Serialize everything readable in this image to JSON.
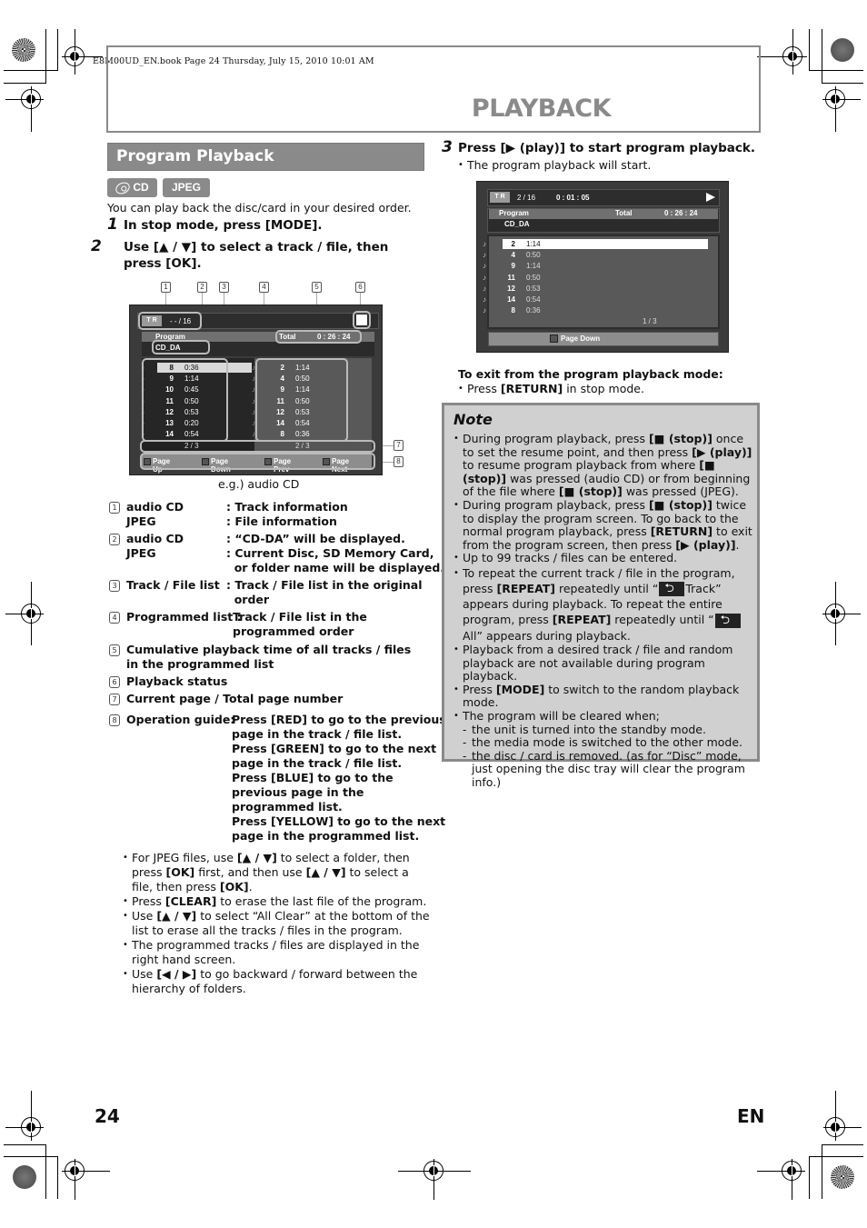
{
  "print_header": "E8M00UD_EN.book  Page 24  Thursday, July 15, 2010  10:01 AM",
  "chapter_title": "PLAYBACK",
  "section_title": "Program Playback",
  "media_badges": [
    "CD",
    "JPEG"
  ],
  "intro": "You can play back the disc/card in your desired order.",
  "steps": [
    {
      "num": "1",
      "text": "In stop mode, press [MODE]."
    },
    {
      "num": "2",
      "text": "Use [▲ / ▼] to select a track / file, then press [OK]."
    },
    {
      "num": "3",
      "text": "Press [▶ (play)] to start program playback.",
      "sub": "The program playback will start."
    }
  ],
  "screen1": {
    "tr_label": "T R",
    "tr_value": "- - / 16",
    "program_label": "Program",
    "source": "CD_DA",
    "total_label": "Total",
    "total_value": "0 : 26 : 24",
    "left_tracks": [
      {
        "num": "8",
        "time": "0:36",
        "selected": true
      },
      {
        "num": "9",
        "time": "1:14"
      },
      {
        "num": "10",
        "time": "0:45"
      },
      {
        "num": "11",
        "time": "0:50"
      },
      {
        "num": "12",
        "time": "0:53"
      },
      {
        "num": "13",
        "time": "0:20"
      },
      {
        "num": "14",
        "time": "0:54"
      }
    ],
    "right_tracks": [
      {
        "num": "2",
        "time": "1:14"
      },
      {
        "num": "4",
        "time": "0:50"
      },
      {
        "num": "9",
        "time": "1:14"
      },
      {
        "num": "11",
        "time": "0:50"
      },
      {
        "num": "12",
        "time": "0:53"
      },
      {
        "num": "14",
        "time": "0:54"
      },
      {
        "num": "8",
        "time": "0:36"
      }
    ],
    "left_page": "2  /  3",
    "right_page": "2  /  3",
    "guide": [
      "Page Up",
      "Page Down",
      "Page Prev",
      "Page Next"
    ],
    "callouts": [
      "1",
      "2",
      "3",
      "4",
      "5",
      "6",
      "7",
      "8"
    ],
    "caption": "e.g.) audio CD"
  },
  "descriptions": [
    {
      "num": "1",
      "rows": [
        [
          "audio CD",
          ": Track information"
        ],
        [
          "JPEG",
          ": File information"
        ]
      ]
    },
    {
      "num": "2",
      "rows": [
        [
          "audio CD",
          ": “CD-DA” will be displayed."
        ],
        [
          "JPEG",
          ": Current Disc, SD Memory Card,"
        ],
        [
          "",
          "  or folder name will be displayed."
        ]
      ]
    },
    {
      "num": "3",
      "rows": [
        [
          "Track / File list",
          ": Track / File list in the original"
        ],
        [
          "",
          "  order"
        ]
      ]
    },
    {
      "num": "4",
      "rows": [
        [
          "Programmed list :",
          "Track / File list in the"
        ],
        [
          "",
          "programmed order"
        ]
      ]
    },
    {
      "num": "5",
      "text": "Cumulative playback time of all tracks / files in the programmed list"
    },
    {
      "num": "6",
      "text": "Playback status"
    },
    {
      "num": "7",
      "text": "Current page / Total page number"
    },
    {
      "num": "8",
      "label": "Operation guide:",
      "lines": [
        "Press [RED] to go to the previous",
        "page in the track / file list.",
        "Press [GREEN] to go to the next",
        "page in the track / file list.",
        "Press [BLUE] to go to the",
        "previous page in the",
        "programmed list.",
        "Press [YELLOW] to go to the next",
        "page in the programmed list."
      ]
    }
  ],
  "bullets_left": [
    "For JPEG files, use [▲ / ▼] to select a folder, then press [OK] first, and then use [▲ / ▼] to select a file, then press [OK].",
    "Press [CLEAR] to erase the last file of the program.",
    "Use [▲ / ▼] to select “All Clear” at the bottom of the list to erase all the tracks / files in the program.",
    "The programmed tracks / files are displayed in the right hand screen.",
    "Use [◀ / ▶] to go backward / forward between the hierarchy of folders."
  ],
  "screen2": {
    "tr_label": "T R",
    "tr_value": "2 / 16",
    "elapsed": "0 : 01 : 05",
    "program_label": "Program",
    "source": "CD_DA",
    "total_label": "Total",
    "total_value": "0 : 26 : 24",
    "tracks": [
      {
        "num": "2",
        "time": "1:14",
        "selected": true
      },
      {
        "num": "4",
        "time": "0:50"
      },
      {
        "num": "9",
        "time": "1:14"
      },
      {
        "num": "11",
        "time": "0:50"
      },
      {
        "num": "12",
        "time": "0:53"
      },
      {
        "num": "14",
        "time": "0:54"
      },
      {
        "num": "8",
        "time": "0:36"
      }
    ],
    "page": "1  /  3",
    "guide": "Page Down"
  },
  "exit": {
    "title": "To exit from the program playback mode:",
    "text": "Press [RETURN] in stop mode."
  },
  "note": {
    "title": "Note",
    "items": [
      "During program playback, press [■ (stop)] once to set the resume point, and then press [▶ (play)] to resume program playback from where [■ (stop)] was pressed (audio CD) or from beginning of the file where [■ (stop)] was pressed (JPEG).",
      "During program playback, press [■ (stop)] twice to display the program screen. To go back to the normal program playback, press [RETURN] to exit from the program screen, then press [▶ (play)].",
      "Up to 99 tracks / files can be entered.",
      "REPEAT_ITEM",
      "Playback from a desired track / file and random playback are not available during program playback.",
      "Press [MODE] to switch to the random playback mode.",
      "The program will be cleared when;"
    ],
    "repeat": {
      "a": "To repeat the current track / file in the program, press",
      "b": "[REPEAT]",
      "c": " repeatedly until “",
      "d": "Track” appears during playback. To repeat the entire program, press ",
      "e": "[REPEAT]",
      "f": " repeatedly until “",
      "g": "All” appears during playback."
    },
    "sub_items": [
      "the unit is turned into the standby mode.",
      "the media mode is switched to the other mode.",
      "the disc / card is removed. (as for “Disc” mode, just opening the disc tray will clear the program info.)"
    ]
  },
  "footer": {
    "page_number": "24",
    "language": "EN"
  }
}
